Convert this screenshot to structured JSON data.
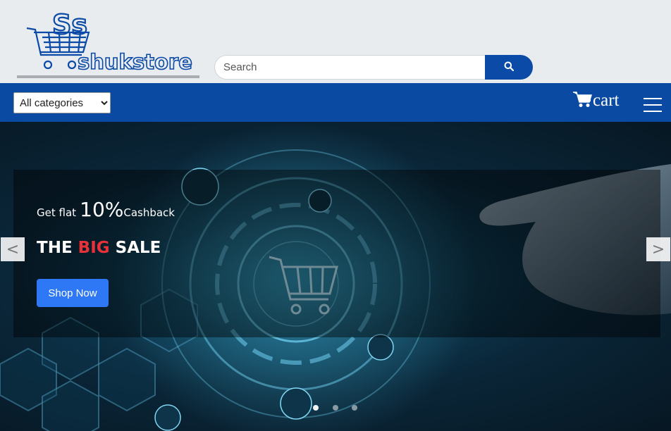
{
  "header": {
    "logo_text_top": "Ss",
    "logo_text": "shukstore",
    "search": {
      "placeholder": "Search",
      "value": "",
      "button_icon": "search-icon"
    }
  },
  "nav": {
    "category_select": {
      "selected": "All categories"
    },
    "cart_label": "cart",
    "cart_icon": "cart-icon",
    "menu_icon": "hamburger-menu-icon"
  },
  "carousel": {
    "tagline_prefix": "Get flat",
    "tagline_value": "10%",
    "tagline_suffix": "Cashback",
    "headline_pre": "THE",
    "headline_accent": "BIG",
    "headline_post": "SALE",
    "cta_label": "Shop Now",
    "prev_label": "<",
    "next_label": ">",
    "active_slide": 1,
    "slide_count": 3
  },
  "colors": {
    "brand_blue": "#0a4aa3",
    "cta_blue": "#2f78f5",
    "accent_red": "#e8323a",
    "header_bg": "#e9ecef"
  }
}
